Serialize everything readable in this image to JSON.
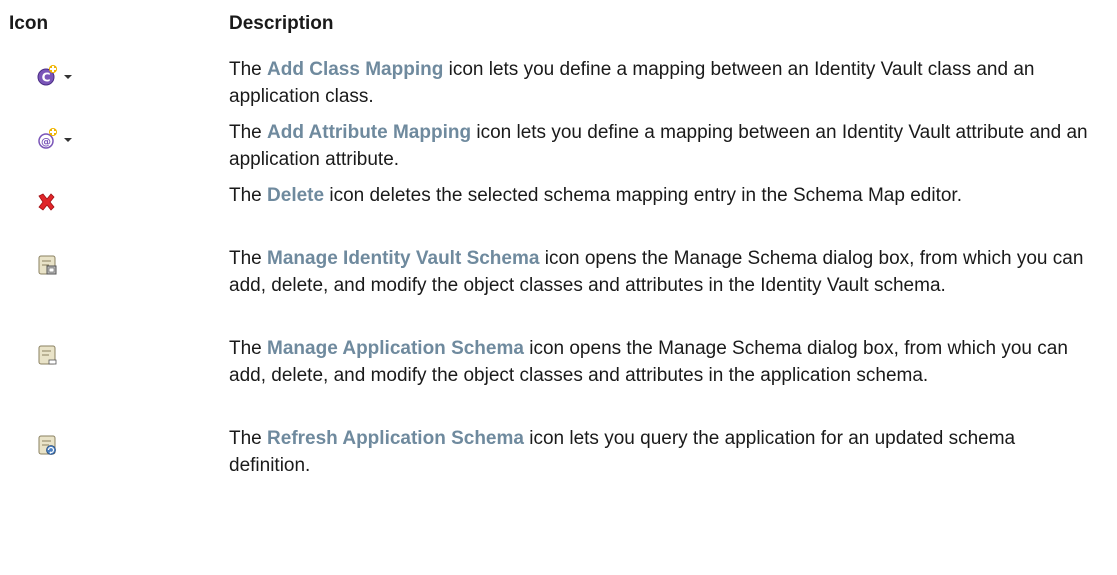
{
  "headers": {
    "icon": "Icon",
    "description": "Description"
  },
  "rows": [
    {
      "icon": "add-class-mapping-icon",
      "prefix": "The ",
      "name": "Add Class Mapping",
      "suffix": " icon lets you define a mapping between an Identity Vault class and an application class."
    },
    {
      "icon": "add-attribute-mapping-icon",
      "prefix": "The ",
      "name": "Add Attribute Mapping",
      "suffix": " icon lets you define a mapping between an Identity Vault attribute and an application attribute."
    },
    {
      "icon": "delete-icon",
      "prefix": "The ",
      "name": "Delete",
      "suffix": " icon deletes the selected schema mapping entry in the Schema Map editor."
    },
    {
      "icon": "manage-identity-vault-schema-icon",
      "prefix": "The ",
      "name": "Manage Identity Vault Schema",
      "suffix": " icon opens the Manage Schema dialog box, from which you can add, delete, and modify the object classes and attributes in the Identity Vault schema."
    },
    {
      "icon": "manage-application-schema-icon",
      "prefix": "The ",
      "name": "Manage Application Schema",
      "suffix": " icon opens the Manage Schema dialog box, from which you can add, delete, and modify the object classes and attributes in the application schema."
    },
    {
      "icon": "refresh-application-schema-icon",
      "prefix": "The ",
      "name": "Refresh Application Schema",
      "suffix": " icon lets you query the application for an updated schema definition."
    }
  ],
  "colors": {
    "term": "#6f8a9e",
    "text": "#1a1a1a"
  }
}
